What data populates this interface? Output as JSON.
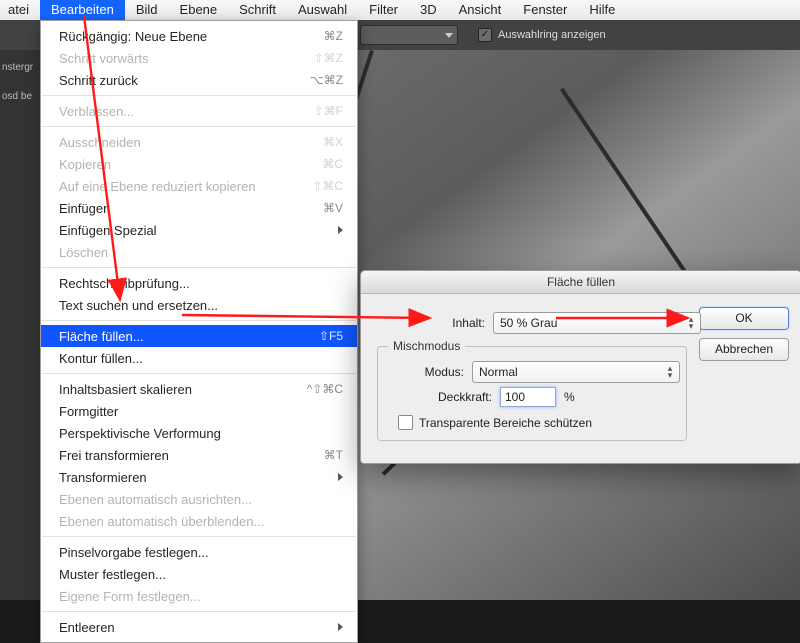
{
  "menubar": {
    "items": [
      "atei",
      "Bearbeiten",
      "Bild",
      "Ebene",
      "Schrift",
      "Auswahl",
      "Filter",
      "3D",
      "Ansicht",
      "Fenster",
      "Hilfe"
    ],
    "active_index": 1
  },
  "optbar": {
    "checkbox_label": "Auswahlring anzeigen",
    "checkbox_checked": true
  },
  "left_strip": {
    "line1": "nstergr",
    "line2": "osd be"
  },
  "dropdown": {
    "groups": [
      [
        {
          "label": "Rückgängig: Neue Ebene",
          "shortcut": "⌘Z",
          "enabled": true
        },
        {
          "label": "Schritt vorwärts",
          "shortcut": "⇧⌘Z",
          "enabled": false
        },
        {
          "label": "Schritt zurück",
          "shortcut": "⌥⌘Z",
          "enabled": true
        }
      ],
      [
        {
          "label": "Verblassen...",
          "shortcut": "⇧⌘F",
          "enabled": false
        }
      ],
      [
        {
          "label": "Ausschneiden",
          "shortcut": "⌘X",
          "enabled": false
        },
        {
          "label": "Kopieren",
          "shortcut": "⌘C",
          "enabled": false
        },
        {
          "label": "Auf eine Ebene reduziert kopieren",
          "shortcut": "⇧⌘C",
          "enabled": false
        },
        {
          "label": "Einfügen",
          "shortcut": "⌘V",
          "enabled": true
        },
        {
          "label": "Einfügen Spezial",
          "submenu": true,
          "enabled": true
        },
        {
          "label": "Löschen",
          "enabled": false
        }
      ],
      [
        {
          "label": "Rechtschreibprüfung...",
          "enabled": true
        },
        {
          "label": "Text suchen und ersetzen...",
          "enabled": true
        }
      ],
      [
        {
          "label": "Fläche füllen...",
          "shortcut": "⇧F5",
          "enabled": true,
          "highlight": true
        },
        {
          "label": "Kontur füllen...",
          "enabled": true
        }
      ],
      [
        {
          "label": "Inhaltsbasiert skalieren",
          "shortcut": "^⇧⌘C",
          "enabled": true
        },
        {
          "label": "Formgitter",
          "enabled": true
        },
        {
          "label": "Perspektivische Verformung",
          "enabled": true
        },
        {
          "label": "Frei transformieren",
          "shortcut": "⌘T",
          "enabled": true
        },
        {
          "label": "Transformieren",
          "submenu": true,
          "enabled": true
        },
        {
          "label": "Ebenen automatisch ausrichten...",
          "enabled": false
        },
        {
          "label": "Ebenen automatisch überblenden...",
          "enabled": false
        }
      ],
      [
        {
          "label": "Pinselvorgabe festlegen...",
          "enabled": true
        },
        {
          "label": "Muster festlegen...",
          "enabled": true
        },
        {
          "label": "Eigene Form festlegen...",
          "enabled": false
        }
      ],
      [
        {
          "label": "Entleeren",
          "submenu": true,
          "enabled": true
        }
      ]
    ]
  },
  "dialog": {
    "title": "Fläche füllen",
    "content_label": "Inhalt:",
    "content_value": "50 % Grau",
    "fieldset_legend": "Mischmodus",
    "mode_label": "Modus:",
    "mode_value": "Normal",
    "opacity_label": "Deckkraft:",
    "opacity_value": "100",
    "opacity_unit": "%",
    "transparent_label": "Transparente Bereiche schützen",
    "ok": "OK",
    "cancel": "Abbrechen"
  },
  "colors": {
    "arrow": "#ff1a1a"
  }
}
